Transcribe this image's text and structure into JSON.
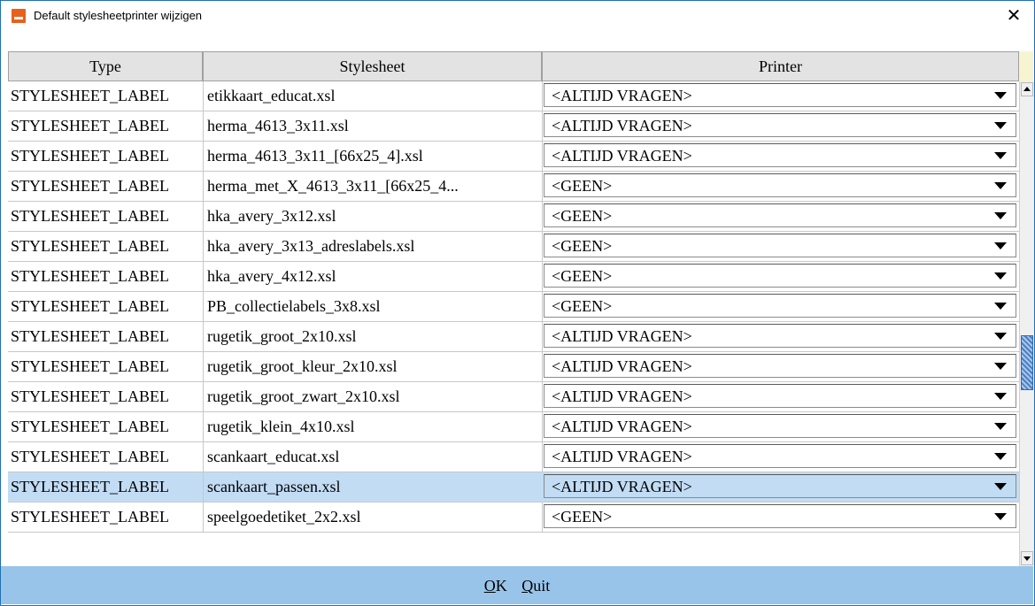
{
  "window": {
    "title": "Default stylesheetprinter wijzigen",
    "close_glyph": "✕"
  },
  "columns": {
    "type": "Type",
    "stylesheet": "Stylesheet",
    "printer": "Printer"
  },
  "rows": [
    {
      "type": "STYLESHEET_LABEL",
      "stylesheet": "etikkaart_educat.xsl",
      "printer": "<ALTIJD VRAGEN>"
    },
    {
      "type": "STYLESHEET_LABEL",
      "stylesheet": "herma_4613_3x11.xsl",
      "printer": "<ALTIJD VRAGEN>"
    },
    {
      "type": "STYLESHEET_LABEL",
      "stylesheet": "herma_4613_3x11_[66x25_4].xsl",
      "printer": "<ALTIJD VRAGEN>"
    },
    {
      "type": "STYLESHEET_LABEL",
      "stylesheet": "herma_met_X_4613_3x11_[66x25_4...",
      "printer": "<GEEN>"
    },
    {
      "type": "STYLESHEET_LABEL",
      "stylesheet": "hka_avery_3x12.xsl",
      "printer": "<GEEN>"
    },
    {
      "type": "STYLESHEET_LABEL",
      "stylesheet": "hka_avery_3x13_adreslabels.xsl",
      "printer": "<GEEN>"
    },
    {
      "type": "STYLESHEET_LABEL",
      "stylesheet": "hka_avery_4x12.xsl",
      "printer": "<GEEN>"
    },
    {
      "type": "STYLESHEET_LABEL",
      "stylesheet": "PB_collectielabels_3x8.xsl",
      "printer": "<GEEN>"
    },
    {
      "type": "STYLESHEET_LABEL",
      "stylesheet": "rugetik_groot_2x10.xsl",
      "printer": "<ALTIJD VRAGEN>"
    },
    {
      "type": "STYLESHEET_LABEL",
      "stylesheet": "rugetik_groot_kleur_2x10.xsl",
      "printer": "<ALTIJD VRAGEN>"
    },
    {
      "type": "STYLESHEET_LABEL",
      "stylesheet": "rugetik_groot_zwart_2x10.xsl",
      "printer": "<ALTIJD VRAGEN>"
    },
    {
      "type": "STYLESHEET_LABEL",
      "stylesheet": "rugetik_klein_4x10.xsl",
      "printer": "<ALTIJD VRAGEN>"
    },
    {
      "type": "STYLESHEET_LABEL",
      "stylesheet": "scankaart_educat.xsl",
      "printer": "<ALTIJD VRAGEN>"
    },
    {
      "type": "STYLESHEET_LABEL",
      "stylesheet": "scankaart_passen.xsl",
      "printer": "<ALTIJD VRAGEN>",
      "selected": true
    },
    {
      "type": "STYLESHEET_LABEL",
      "stylesheet": "speelgoedetiket_2x2.xsl",
      "printer": "<GEEN>"
    }
  ],
  "footer": {
    "ok_mnemonic": "O",
    "ok_rest": "K",
    "quit_mnemonic": "Q",
    "quit_rest": "uit"
  },
  "colors": {
    "selected_row": "#c2dcf4",
    "footer": "#99c4ea",
    "header": "#e3e3e3",
    "app_icon": "#e8601c"
  }
}
